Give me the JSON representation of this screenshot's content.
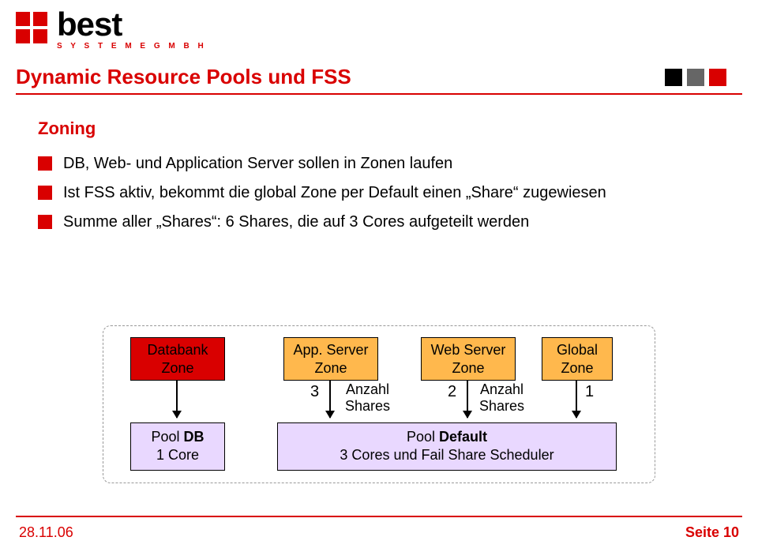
{
  "brand": {
    "name": "best",
    "tagline": "S Y S T E M E  G M B H"
  },
  "title": "Dynamic Resource Pools und FSS",
  "subhead": "Zoning",
  "bullets": [
    "DB, Web- und Application Server sollen in Zonen laufen",
    "Ist FSS aktiv, bekommt die global Zone per Default einen „Share“ zugewiesen",
    "Summe aller „Shares“: 6 Shares, die auf 3 Cores aufgeteilt werden"
  ],
  "diagram": {
    "zones": [
      {
        "line1": "Databank",
        "line2": "Zone"
      },
      {
        "line1": "App. Server",
        "line2": "Zone"
      },
      {
        "line1": "Web Server",
        "line2": "Zone"
      },
      {
        "line1": "Global",
        "line2": "Zone"
      }
    ],
    "share_numbers": [
      "3",
      "2",
      "1"
    ],
    "share_label": "Anzahl\nShares",
    "pools": [
      {
        "prefix": "Pool ",
        "bold": "DB",
        "line2": "1 Core"
      },
      {
        "prefix": "Pool ",
        "bold": "Default",
        "line2": "3 Cores und Fail Share Scheduler"
      }
    ]
  },
  "footer": {
    "date": "28.11.06",
    "page_label": "Seite 10"
  },
  "colors": {
    "accent": "#d90000",
    "zone_default": "#ffb84d",
    "pool": "#e9d8ff"
  }
}
